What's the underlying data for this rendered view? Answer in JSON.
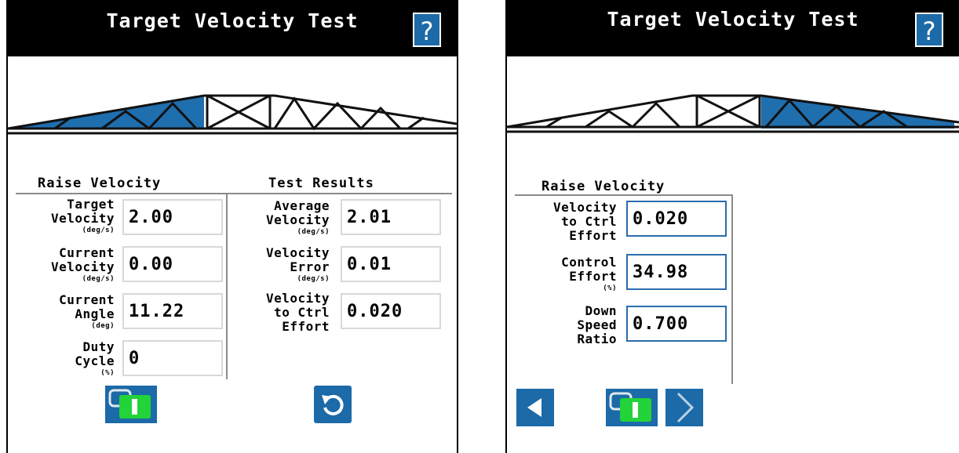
{
  "left_screen": {
    "title": "Target Velocity Test",
    "help_label": "?",
    "raise_section": {
      "title": "Raise Velocity",
      "fields": [
        {
          "label_line1": "Target",
          "label_line2": "Velocity",
          "unit": "(deg/s)",
          "value": "2.00"
        },
        {
          "label_line1": "Current",
          "label_line2": "Velocity",
          "unit": "(deg/s)",
          "value": "0.00"
        },
        {
          "label_line1": "Current",
          "label_line2": "Angle",
          "unit": "(deg)",
          "value": "11.22"
        },
        {
          "label_line1": "Duty",
          "label_line2": "Cycle",
          "unit": "(%)",
          "value": "0"
        }
      ]
    },
    "results_section": {
      "title": "Test Results",
      "fields": [
        {
          "label_line1": "Average",
          "label_line2": "Velocity",
          "unit": "(deg/s)",
          "value": "2.01"
        },
        {
          "label_line1": "Velocity",
          "label_line2": "Error",
          "unit": "(deg/s)",
          "value": "0.01"
        },
        {
          "label_line1": "Velocity",
          "label_line2": "to Ctrl",
          "label_line3": "Effort",
          "value": "0.020"
        }
      ]
    },
    "boom_highlight": "left"
  },
  "right_screen": {
    "title": "Target Velocity Test",
    "help_label": "?",
    "raise_section": {
      "title": "Raise Velocity",
      "fields": [
        {
          "label_line1": "Velocity",
          "label_line2": "to Ctrl",
          "label_line3": "Effort",
          "value": "0.020"
        },
        {
          "label_line1": "Control",
          "label_line2": "Effort",
          "unit": "(%)",
          "value": "34.98"
        },
        {
          "label_line1": "Down",
          "label_line2": "Speed",
          "label_line3": "Ratio",
          "value": "0.700"
        }
      ]
    },
    "boom_highlight": "right"
  },
  "colors": {
    "header_bg": "#000000",
    "accent_blue": "#1c6aa8",
    "boom_blue": "#1f6eae",
    "toggle_green": "#22d33a",
    "field_border_grey": "#d8d8d8"
  },
  "icons": {
    "help": "question-icon",
    "toggle": "toggle-switch-icon",
    "reset": "reset-icon",
    "back": "back-arrow-icon",
    "next": "next-arrow-icon"
  }
}
